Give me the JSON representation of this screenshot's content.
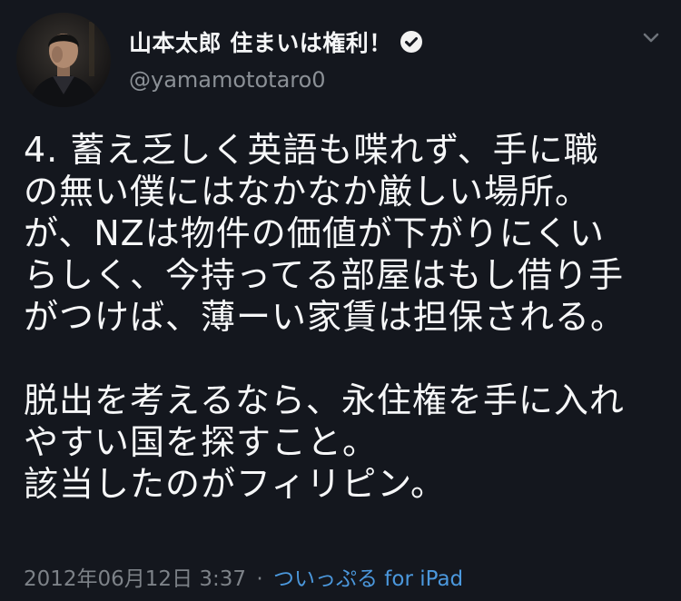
{
  "tweet": {
    "display_name": "山本太郎 住まいは権利！",
    "handle": "@yamamototaro0",
    "verified": true,
    "body_lines": [
      "4.  蓄え乏しく英語も喋れず、手に職",
      "の無い僕にはなかなか厳しい場所。",
      "が、NZは物件の価値が下がりにくい",
      "らしく、今持ってる部屋はもし借り手",
      "がつけば、薄ーい家賃は担保される。",
      "",
      "脱出を考えるなら、永住権を手に入れ",
      "やすい国を探すこと。",
      "該当したのがフィリピン。"
    ],
    "timestamp": "2012年06月12日 3:37",
    "separator": "·",
    "source_app": "ついっぷる for iPad",
    "colors": {
      "background": "#14171e",
      "text": "#f6f7f8",
      "muted": "#8b9096",
      "link": "#4b98dd"
    },
    "icons": {
      "verified": "verified-badge-icon",
      "menu": "chevron-down-icon"
    }
  }
}
